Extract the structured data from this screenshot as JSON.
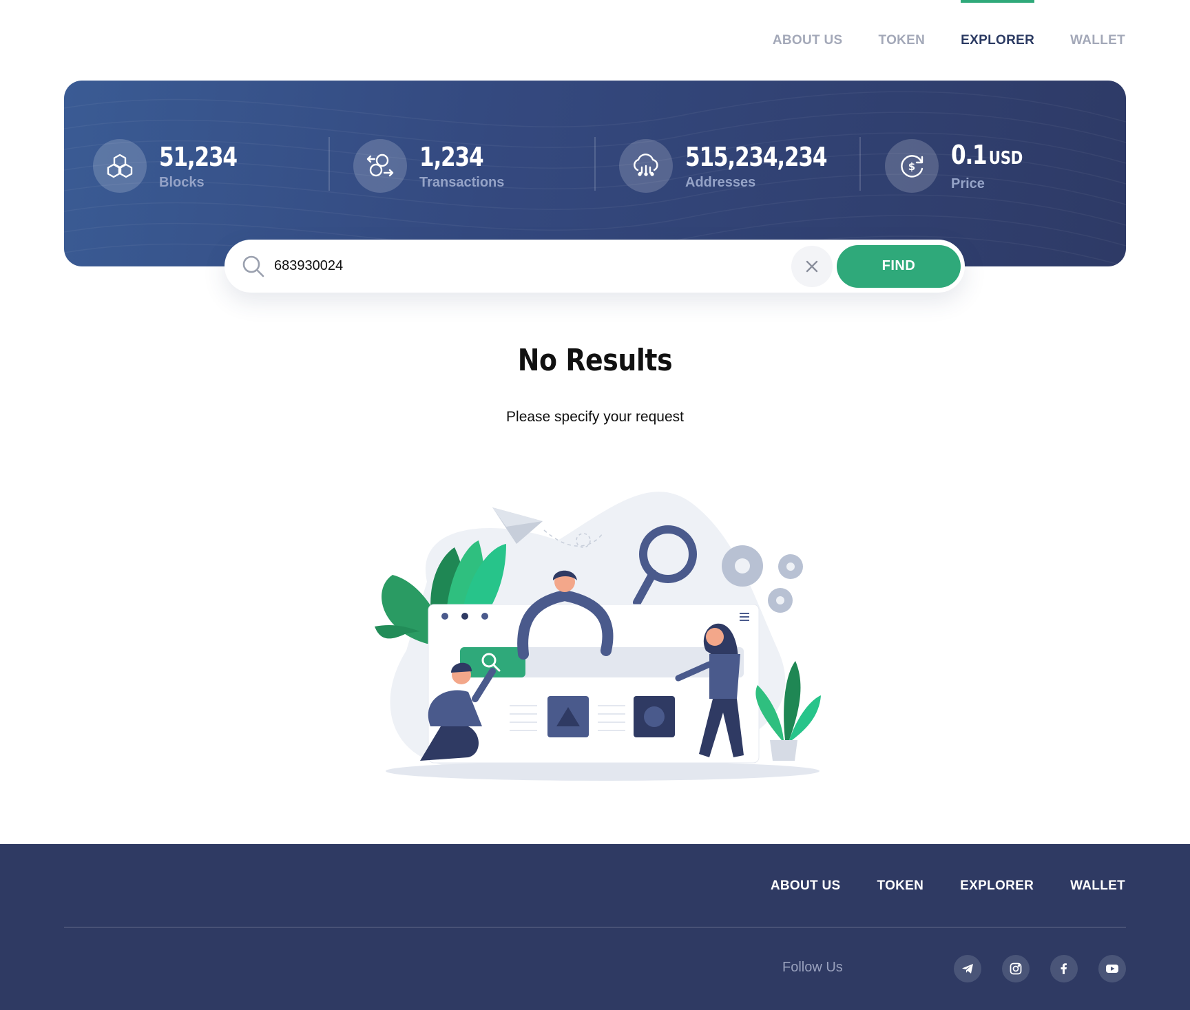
{
  "nav": {
    "items": [
      {
        "label": "ABOUT US"
      },
      {
        "label": "TOKEN"
      },
      {
        "label": "EXPLORER",
        "active": true
      },
      {
        "label": "WALLET"
      }
    ]
  },
  "stats": [
    {
      "value": "51,234",
      "unit": "",
      "label": "Blocks",
      "icon": "blocks-icon"
    },
    {
      "value": "1,234",
      "unit": "",
      "label": "Transactions",
      "icon": "transactions-icon"
    },
    {
      "value": "515,234,234",
      "unit": "",
      "label": "Addresses",
      "icon": "addresses-icon"
    },
    {
      "value": "0.1",
      "unit": "USD",
      "label": "Price",
      "icon": "price-icon"
    }
  ],
  "search": {
    "value": "683930024",
    "find_label": "FIND"
  },
  "result": {
    "title": "No Results",
    "subtitle": "Please specify your request"
  },
  "footer": {
    "nav": [
      {
        "label": "ABOUT US"
      },
      {
        "label": "TOKEN"
      },
      {
        "label": "EXPLORER"
      },
      {
        "label": "WALLET"
      }
    ],
    "follow_label": "Follow Us",
    "socials": [
      "telegram-icon",
      "instagram-icon",
      "facebook-icon",
      "youtube-icon"
    ]
  },
  "colors": {
    "accent": "#2fa97a",
    "hero_start": "#3a5b94",
    "hero_end": "#2e3a66",
    "footer_bg": "#2f3a63",
    "nav_active": "#2b3a62",
    "nav_inactive": "#a3a8b8"
  }
}
